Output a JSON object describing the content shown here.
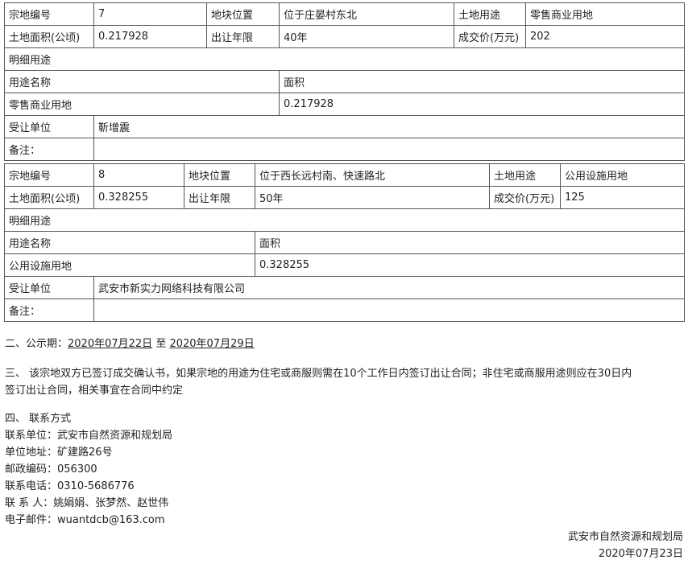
{
  "parcels": [
    {
      "code_label": "宗地编号",
      "code": "7",
      "location_label": "地块位置",
      "location": "位于庄晏村东北",
      "use_label": "土地用途",
      "use": "零售商业用地",
      "area_label": "土地面积(公顷)",
      "area": "0.217928",
      "term_label": "出让年限",
      "term": "40年",
      "price_label": "成交价(万元)",
      "price": "202",
      "detail_label": "明细用途",
      "detail_name_header": "用途名称",
      "detail_area_header": "面积",
      "detail_name": "零售商业用地",
      "detail_area": "0.217928",
      "buyer_label": "受让单位",
      "buyer": "靳增震",
      "remark_label": "备注：",
      "remark": ""
    },
    {
      "code_label": "宗地编号",
      "code": "8",
      "location_label": "地块位置",
      "location": "位于西长远村南、快速路北",
      "use_label": "土地用途",
      "use": "公用设施用地",
      "area_label": "土地面积(公顷)",
      "area": "0.328255",
      "term_label": "出让年限",
      "term": "50年",
      "price_label": "成交价(万元)",
      "price": "125",
      "detail_label": "明细用途",
      "detail_name_header": "用途名称",
      "detail_area_header": "面积",
      "detail_name": "公用设施用地",
      "detail_area": "0.328255",
      "buyer_label": "受让单位",
      "buyer": "武安市新实力网络科技有限公司",
      "remark_label": "备注：",
      "remark": ""
    }
  ],
  "notice": {
    "prefix": "二、公示期：",
    "start": "2020年07月22日",
    "connector": " 至 ",
    "end": "2020年07月29日"
  },
  "contract_note": {
    "line1": "三、 该宗地双方已签订成交确认书，如果宗地的用途为住宅或商服则需在10个工作日内签订出让合同；非住宅或商服用途则应在30日内",
    "line2": "签订出让合同，相关事宜在合同中约定"
  },
  "contact": {
    "heading": "四、 联系方式",
    "unit": "联系单位：武安市自然资源和规划局",
    "address": "单位地址：矿建路26号",
    "postcode": "邮政编码：056300",
    "phone": "联系电话：0310-5686776",
    "persons": "联 系 人：姚娟娟、张梦然、赵世伟",
    "email": "电子邮件：wuantdcb@163.com"
  },
  "signature": {
    "org": "武安市自然资源和规划局",
    "date": "2020年07月23日"
  }
}
